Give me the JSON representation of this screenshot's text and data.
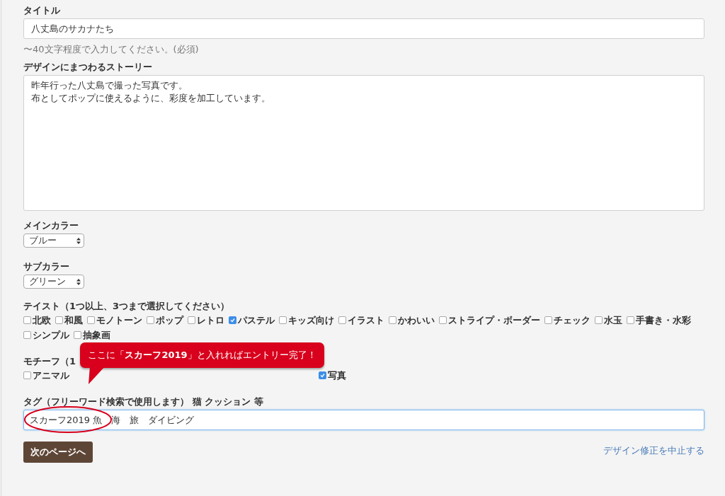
{
  "title_field": {
    "label": "タイトル",
    "value": "八丈島のサカナたち",
    "help": "〜40文字程度で入力してください。(必須)"
  },
  "story_field": {
    "label": "デザインにまつわるストーリー",
    "lines": [
      "昨年行った八丈島で撮った写真です。",
      "布としてポップに使えるように、彩度を加工しています。"
    ]
  },
  "main_color": {
    "label": "メインカラー",
    "value": "ブルー"
  },
  "sub_color": {
    "label": "サブカラー",
    "value": "グリーン"
  },
  "taste": {
    "label": "テイスト（1つ以上、3つまで選択してください）",
    "options": [
      {
        "label": "北欧",
        "checked": false
      },
      {
        "label": "和風",
        "checked": false
      },
      {
        "label": "モノトーン",
        "checked": false
      },
      {
        "label": "ポップ",
        "checked": false
      },
      {
        "label": "レトロ",
        "checked": false
      },
      {
        "label": "パステル",
        "checked": true
      },
      {
        "label": "キッズ向け",
        "checked": false
      },
      {
        "label": "イラスト",
        "checked": false
      },
      {
        "label": "かわいい",
        "checked": false
      },
      {
        "label": "ストライプ・ボーダー",
        "checked": false
      },
      {
        "label": "チェック",
        "checked": false
      },
      {
        "label": "水玉",
        "checked": false
      },
      {
        "label": "手書き・水彩",
        "checked": false
      },
      {
        "label": "シンプル",
        "checked": false
      },
      {
        "label": "抽象画",
        "checked": false
      }
    ]
  },
  "motif": {
    "label": "モチーフ（1",
    "options": [
      {
        "label": "アニマル",
        "checked": false
      },
      {
        "label": "写真",
        "checked": true
      }
    ]
  },
  "callout": {
    "text": "ここに「**スカーフ2019**」と入れればエントリー完了！"
  },
  "tag_field": {
    "label": "タグ（フリーワード検索で使用します） 猫 クッション 等",
    "value": "スカーフ2019 魚　海　旅　ダイビング"
  },
  "next_button": "次のページへ",
  "cancel_link": "デザイン修正を中止する"
}
